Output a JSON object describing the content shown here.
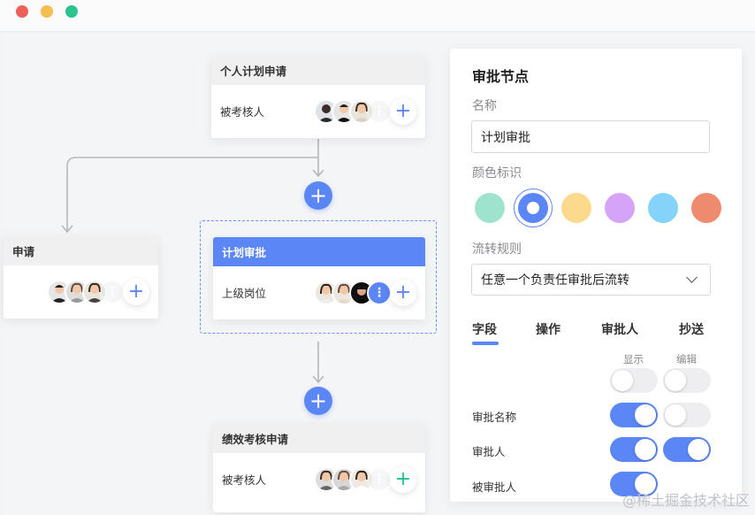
{
  "window": {
    "buttons": {
      "close_color": "#ff5f57",
      "minimize_color": "#febc2e",
      "maximize_color": "#28c840"
    }
  },
  "flow": {
    "nodes": [
      {
        "title": "个人计划申请",
        "role": "被考核人"
      },
      {
        "title": "申请",
        "role": ""
      },
      {
        "title": "计划审批",
        "role": "上级岗位"
      },
      {
        "title": "绩效考核申请",
        "role": "被考核人"
      }
    ]
  },
  "panel": {
    "title": "审批节点",
    "name_label": "名称",
    "name_value": "计划审批",
    "color_label": "颜色标识",
    "colors": [
      "#9fe3cf",
      "#5b86f6",
      "#fbd98d",
      "#d5a4f9",
      "#85d3fa",
      "#ee8a6e"
    ],
    "selected_color_index": 1,
    "rule_label": "流转规则",
    "rule_value": "任意一个负责任审批后流转",
    "tabs": [
      "字段",
      "操作",
      "审批人",
      "抄送"
    ],
    "active_tab": "字段",
    "col_show": "显示",
    "col_edit": "编辑",
    "rows": [
      {
        "label": "",
        "show": false,
        "edit": false
      },
      {
        "label": "审批名称",
        "show": true,
        "edit": false
      },
      {
        "label": "审批人",
        "show": true,
        "edit": true
      },
      {
        "label": "被审批人",
        "show": true,
        "edit": false
      }
    ]
  },
  "watermark": "@稀土掘金技术社区",
  "accent_color": "#5b86f6"
}
